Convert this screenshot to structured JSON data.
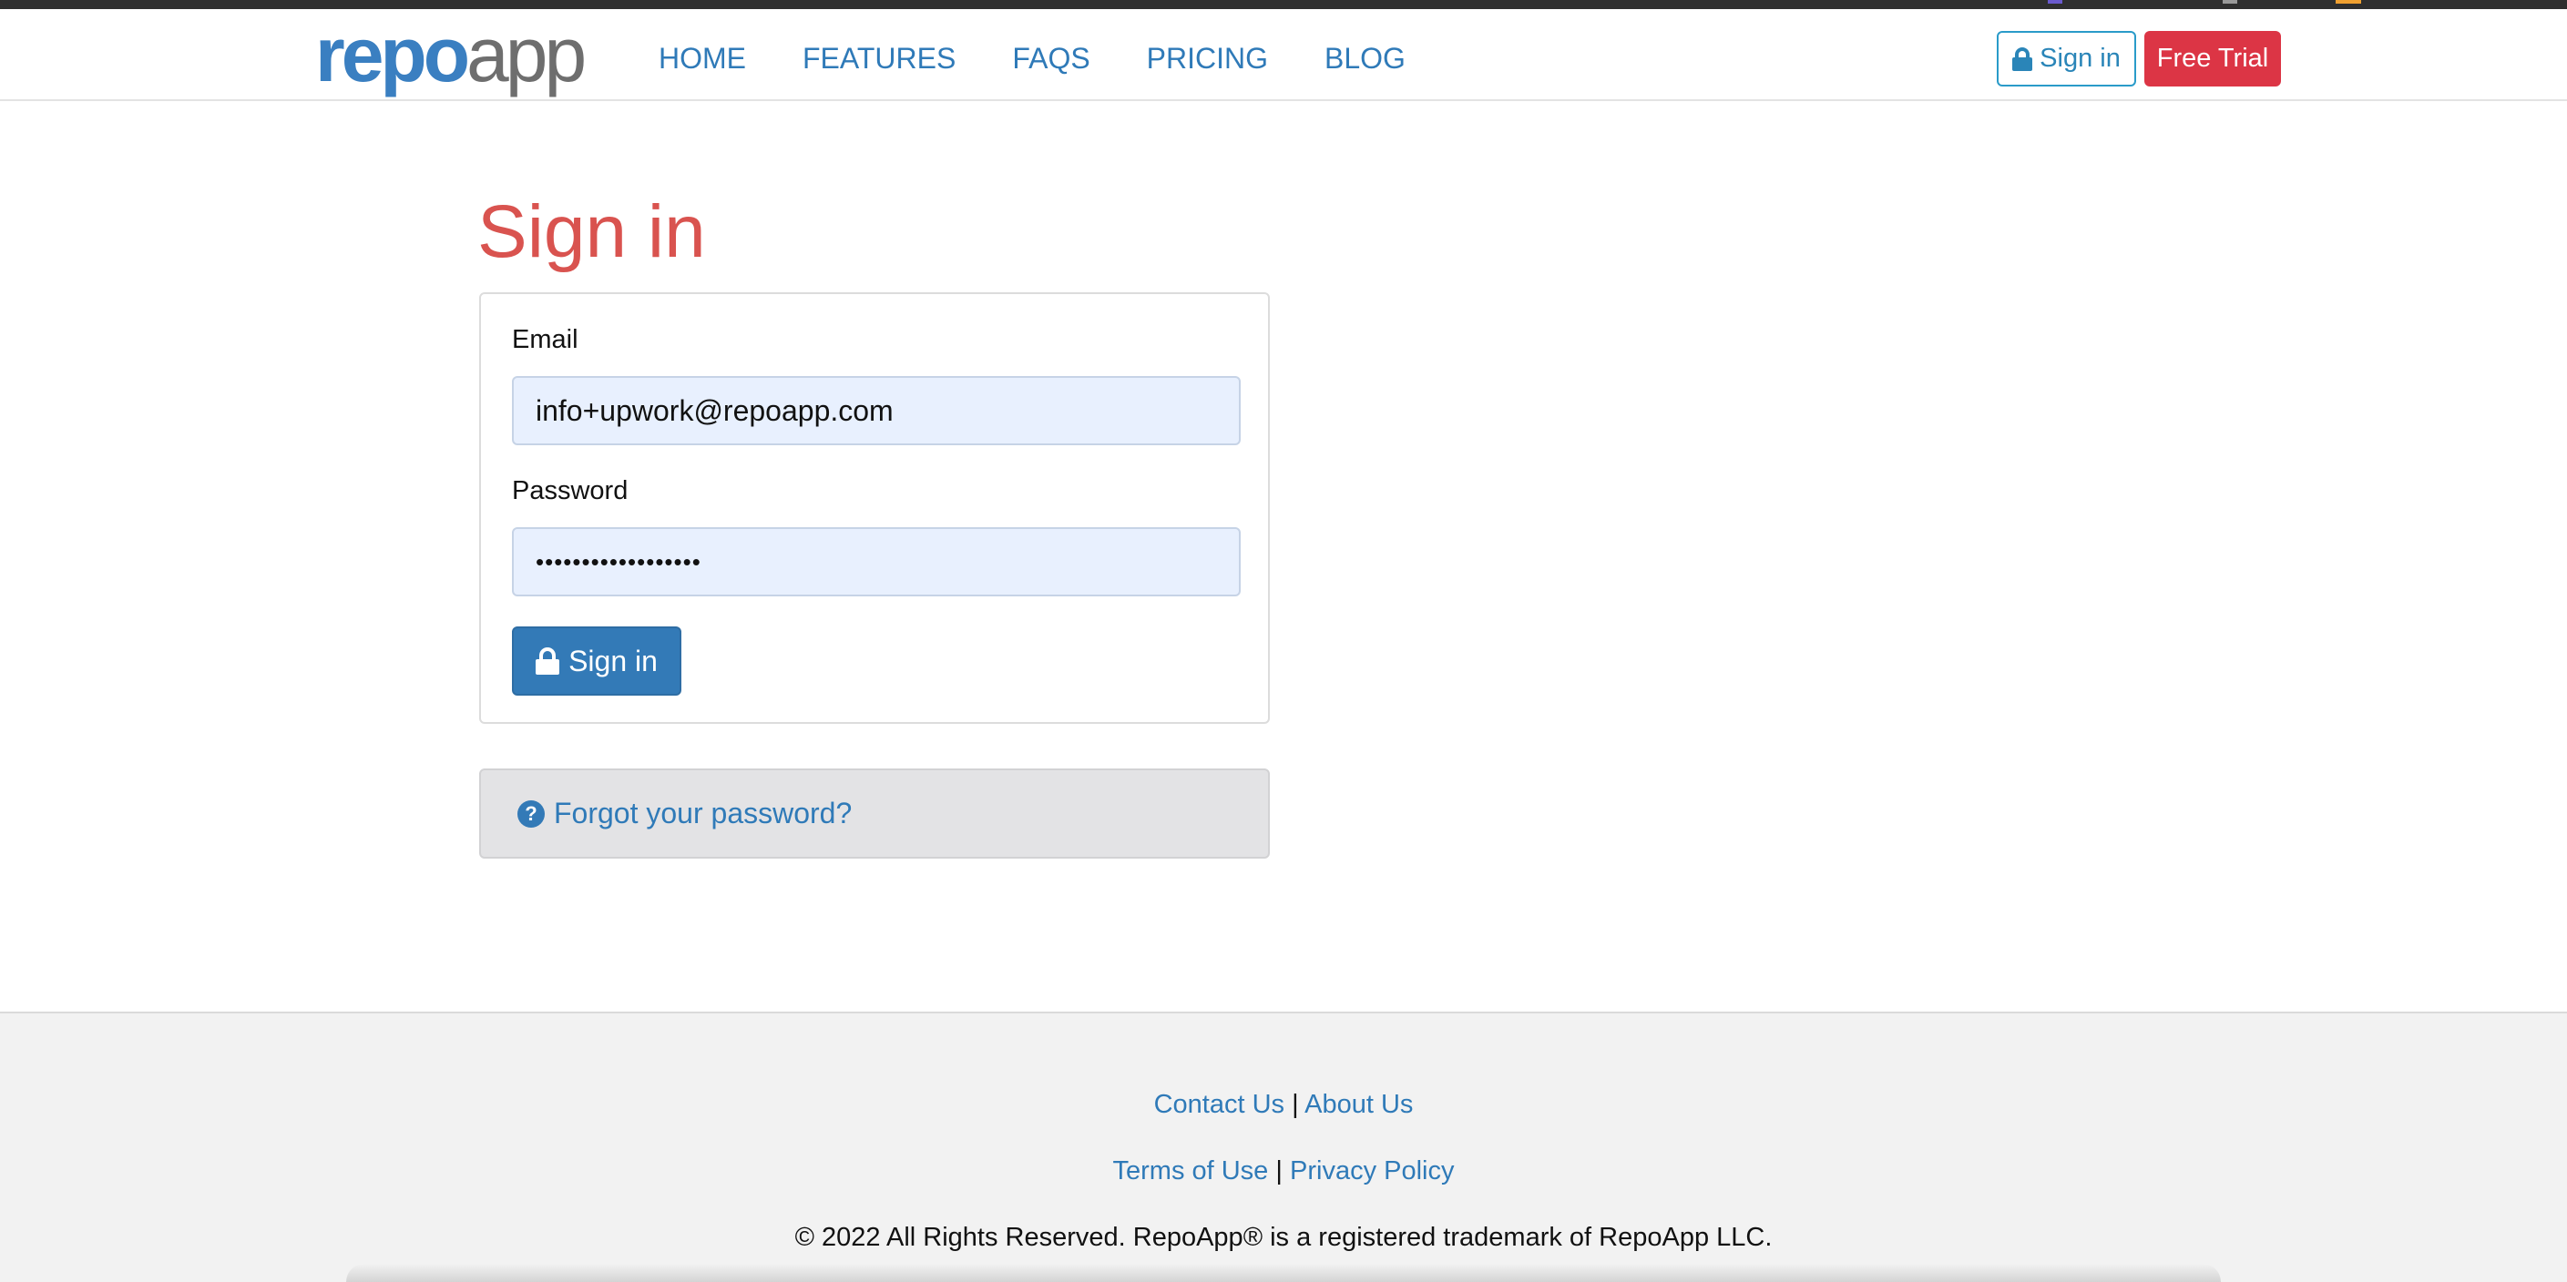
{
  "brand": {
    "logo_repo": "repo",
    "logo_app": "app"
  },
  "nav": {
    "links": [
      "HOME",
      "FEATURES",
      "FAQS",
      "PRICING",
      "BLOG"
    ],
    "signin_label": "Sign in",
    "trial_label": "Free Trial"
  },
  "main": {
    "title": "Sign in",
    "email_label": "Email",
    "email_value": "info+upwork@repoapp.com",
    "password_label": "Password",
    "password_value": "••••••••••••••••••",
    "signin_button": "Sign in",
    "forgot_link": "Forgot your password?"
  },
  "footer": {
    "contact": "Contact Us",
    "about": "About Us",
    "terms": "Terms of Use",
    "privacy": "Privacy Policy",
    "separator": "|",
    "copyright": "© 2022 All Rights Reserved. RepoApp® is a registered trademark of RepoApp LLC."
  },
  "colors": {
    "accent": "#337ab7",
    "danger": "#dc3545",
    "title": "#d9534f",
    "input_bg": "#e8f0fe"
  }
}
